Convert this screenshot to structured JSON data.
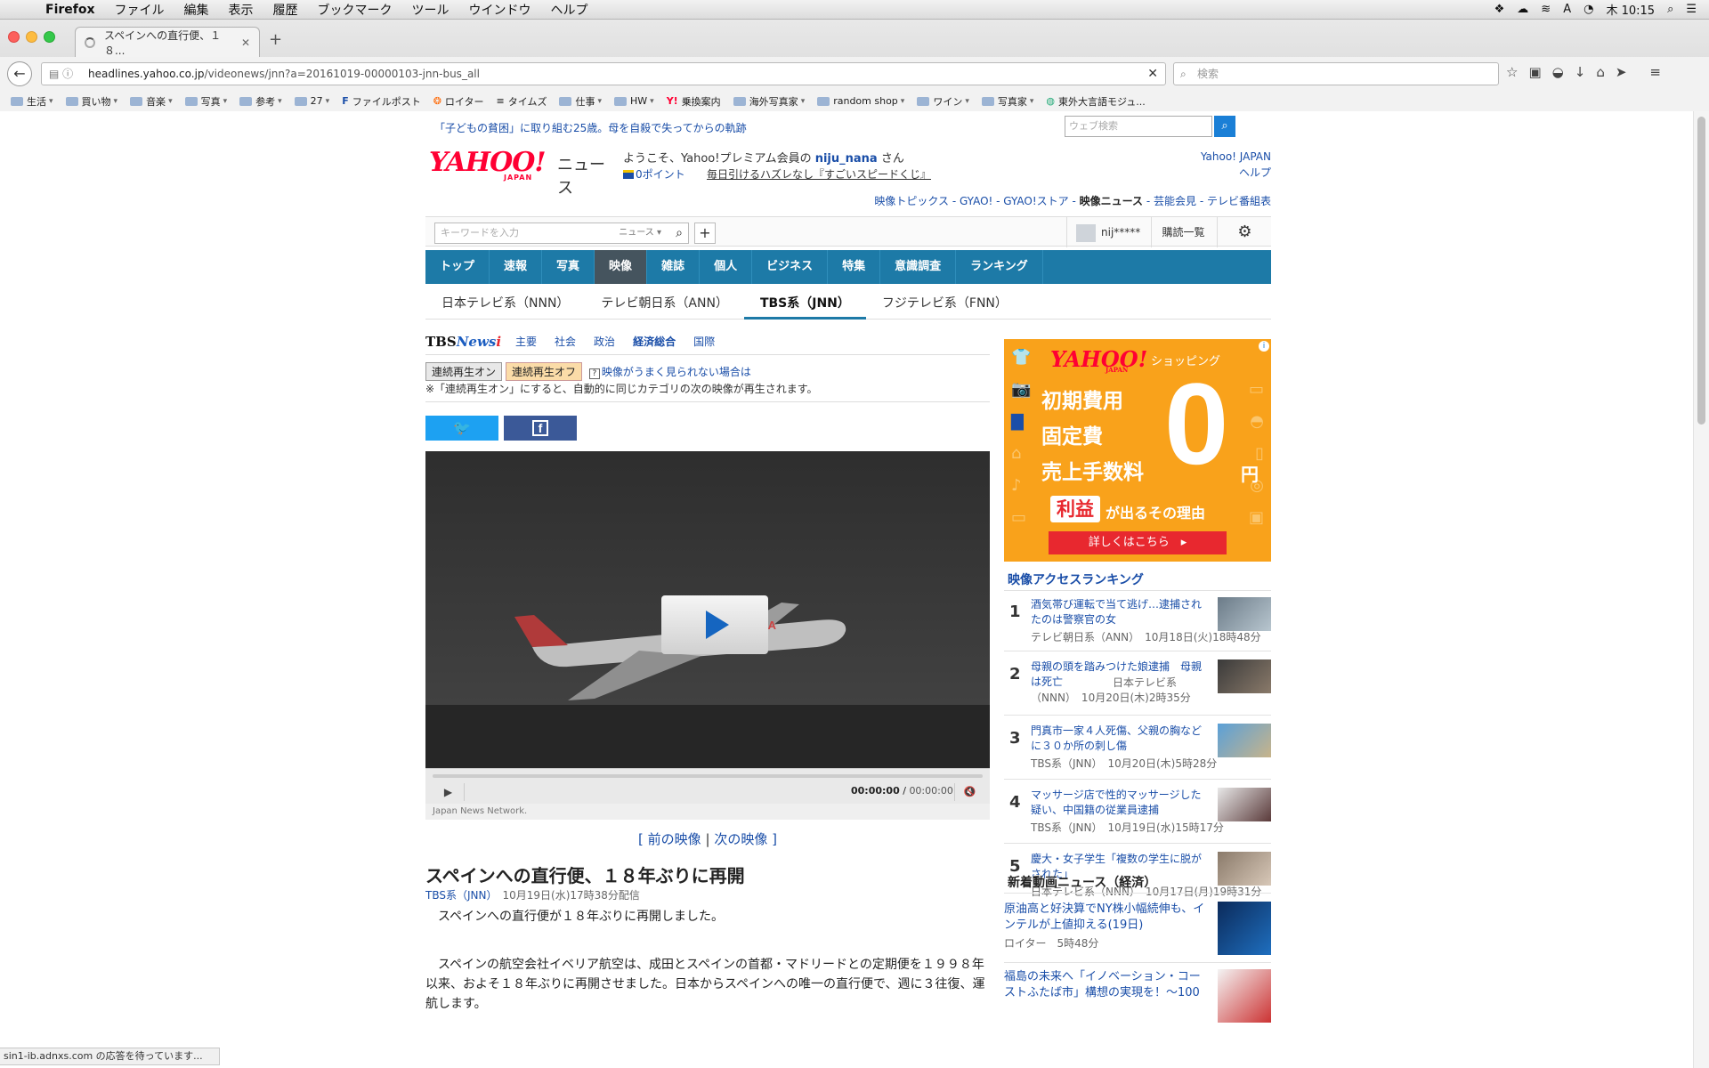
{
  "menubar": {
    "app": "Firefox",
    "items": [
      "ファイル",
      "編集",
      "表示",
      "履歴",
      "ブックマーク",
      "ツール",
      "ウインドウ",
      "ヘルプ"
    ],
    "clock": "木 10:15"
  },
  "browser": {
    "tab_title": "スペインへの直行便、１８...",
    "url_host": "headlines.yahoo.co.jp",
    "url_path": "/videonews/jnn?a=20161019-00000103-jnn-bus_all",
    "search_placeholder": "検索",
    "bookmarks": [
      "生活",
      "買い物",
      "音楽",
      "写真",
      "参考",
      "27",
      "ファイルポスト",
      "ロイター",
      "タイムズ",
      "仕事",
      "HW",
      "乗換案内",
      "海外写真家",
      "random shop",
      "ワイン",
      "写真家",
      "東外大言語モジュ..."
    ],
    "status": "sin1-ib.adnxs.com の応答を待っています..."
  },
  "header": {
    "promo": "「子どもの貧困」に取り組む25歳。母を自殺で失ってからの軌跡",
    "web_search_placeholder": "ウェブ検索",
    "logo": "YAHOO!",
    "logo_sub": "JAPAN",
    "logo_news": "ニュース",
    "welcome_pre": "ようこそ、Yahoo!プレミアム会員の",
    "welcome_user": "niju_nana",
    "welcome_post": "さん",
    "points": "0ポイント",
    "lottery": "毎日引けるハズレなし『すごいスピードくじ』",
    "yj_link": "Yahoo! JAPAN",
    "help_link": "ヘルプ",
    "sub_links": [
      "映像トピックス",
      "GYAO!",
      "GYAO!ストア",
      "映像ニュース",
      "芸能会見",
      "テレビ番組表"
    ],
    "separator": " - ",
    "keyword_placeholder": "キーワードを入力",
    "keyword_cat": "ニュース ▾",
    "user_name": "nij*****",
    "subscriptions": "購読一覧"
  },
  "main_nav": [
    "トップ",
    "速報",
    "写真",
    "映像",
    "雑誌",
    "個人",
    "ビジネス",
    "特集",
    "意識調査",
    "ランキング"
  ],
  "main_nav_active": "映像",
  "sub_nav": [
    "日本テレビ系（NNN）",
    "テレビ朝日系（ANN）",
    "TBS系（JNN）",
    "フジテレビ系（FNN）"
  ],
  "sub_nav_active": "TBS系（JNN）",
  "tbs": {
    "logo_a": "TBS",
    "logo_b": "News",
    "logo_i": "i",
    "cats": [
      "主要",
      "社会",
      "政治",
      "経済総合",
      "国際"
    ],
    "active_cat": "経済総合"
  },
  "autoplay": {
    "on": "連続再生オン",
    "off": "連続再生オフ",
    "help": "映像がうまく見られない場合は",
    "note": "※「連続再生オン」にすると、自動的に同じカテゴリの次の映像が再生されます。"
  },
  "player": {
    "time_current": "00:00:00",
    "time_total": "00:00:00",
    "credit": "Japan News Network.",
    "plane_text": "IBERIA"
  },
  "prev_next": {
    "prev": "前の映像",
    "next": "次の映像"
  },
  "article": {
    "headline": "スペインへの直行便、１８年ぶりに再開",
    "source": "TBS系（JNN）",
    "datetime": "10月19日(水)17時38分配信",
    "p1": "スペインへの直行便が１８年ぶりに再開しました。",
    "p2": "スペインの航空会社イベリア航空は、成田とスペインの首都・マドリードとの定期便を１９９８年以来、およそ１８年ぶりに再開させました。日本からスペインへの唯一の直行便で、週に３往復、運航します。"
  },
  "ad": {
    "logo": "YAHOO!",
    "logo_sub": "JAPAN",
    "shop": "ショッピング",
    "l1": "初期費用",
    "l2": "固定費",
    "l3": "売上手数料",
    "zero": "0",
    "yen": "円",
    "profit": "利益",
    "reason": "が出るその理由",
    "cta": "詳しくはこちら　▸"
  },
  "ranking": {
    "title": "映像アクセスランキング",
    "items": [
      {
        "num": "1",
        "title": "酒気帯び運転で当て逃げ…逮捕されたのは警察官の女",
        "source": "テレビ朝日系（ANN）　10月18日(火)18時48分"
      },
      {
        "num": "2",
        "title": "母親の頭を踏みつけた娘逮捕　母親は死亡",
        "source": "日本テレビ系（NNN）　10月20日(木)2時35分"
      },
      {
        "num": "3",
        "title": "門真市一家４人死傷、父親の胸などに３０か所の刺し傷",
        "source": "TBS系（JNN）　10月20日(木)5時28分"
      },
      {
        "num": "4",
        "title": "マッサージ店で性的マッサージした疑い、中国籍の従業員逮捕",
        "source": "TBS系（JNN）　10月19日(水)15時17分"
      },
      {
        "num": "5",
        "title": "慶大・女子学生「複数の学生に脱がされた」",
        "source": "日本テレビ系（NNN）　10月17日(月)19時31分"
      }
    ]
  },
  "new_videos": {
    "title": "新着動画ニュース（経済）",
    "items": [
      {
        "title": "原油高と好決算でNY株小幅続伸も、インテルが上値抑える(19日)",
        "source": "ロイター　5時48分"
      },
      {
        "title": "福島の未来へ「イノベーション・コーストふたば市」構想の実現を！〜100",
        "source": ""
      }
    ]
  }
}
